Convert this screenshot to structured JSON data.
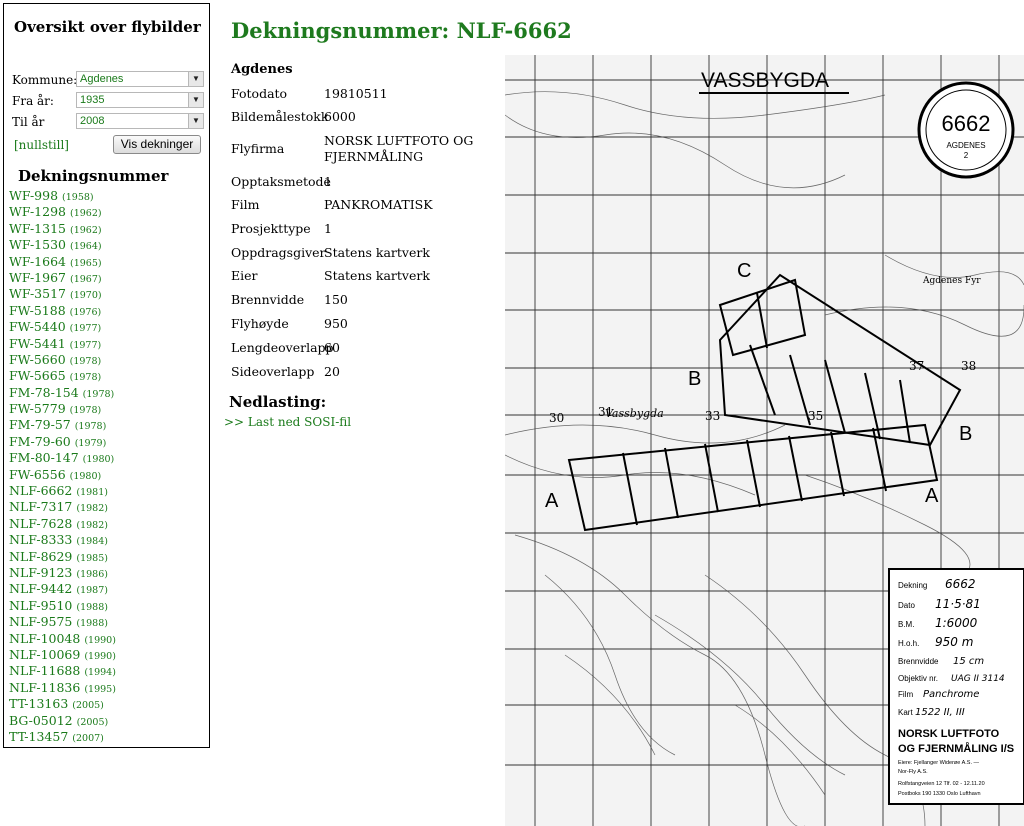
{
  "sidebar": {
    "title": "Oversikt over flybilder",
    "kommune_label": "Kommune:",
    "kommune_value": "Agdenes",
    "fra_label": "Fra år:",
    "fra_value": "1935",
    "til_label": "Til år",
    "til_value": "2008",
    "reset_link": "[nullstill]",
    "show_button": "Vis dekninger",
    "list_heading": "Dekningsnummer",
    "items": [
      {
        "id": "WF-998",
        "year": "(1958)"
      },
      {
        "id": "WF-1298",
        "year": "(1962)"
      },
      {
        "id": "WF-1315",
        "year": "(1962)"
      },
      {
        "id": "WF-1530",
        "year": "(1964)"
      },
      {
        "id": "WF-1664",
        "year": "(1965)"
      },
      {
        "id": "WF-1967",
        "year": "(1967)"
      },
      {
        "id": "WF-3517",
        "year": "(1970)"
      },
      {
        "id": "FW-5188",
        "year": "(1976)"
      },
      {
        "id": "FW-5440",
        "year": "(1977)"
      },
      {
        "id": "FW-5441",
        "year": "(1977)"
      },
      {
        "id": "FW-5660",
        "year": "(1978)"
      },
      {
        "id": "FW-5665",
        "year": "(1978)"
      },
      {
        "id": "FM-78-154",
        "year": "(1978)"
      },
      {
        "id": "FW-5779",
        "year": "(1978)"
      },
      {
        "id": "FM-79-57",
        "year": "(1978)"
      },
      {
        "id": "FM-79-60",
        "year": "(1979)"
      },
      {
        "id": "FM-80-147",
        "year": "(1980)"
      },
      {
        "id": "FW-6556",
        "year": "(1980)"
      },
      {
        "id": "NLF-6662",
        "year": "(1981)"
      },
      {
        "id": "NLF-7317",
        "year": "(1982)"
      },
      {
        "id": "NLF-7628",
        "year": "(1982)"
      },
      {
        "id": "NLF-8333",
        "year": "(1984)"
      },
      {
        "id": "NLF-8629",
        "year": "(1985)"
      },
      {
        "id": "NLF-9123",
        "year": "(1986)"
      },
      {
        "id": "NLF-9442",
        "year": "(1987)"
      },
      {
        "id": "NLF-9510",
        "year": "(1988)"
      },
      {
        "id": "NLF-9575",
        "year": "(1988)"
      },
      {
        "id": "NLF-10048",
        "year": "(1990)"
      },
      {
        "id": "NLF-10069",
        "year": "(1990)"
      },
      {
        "id": "NLF-11688",
        "year": "(1994)"
      },
      {
        "id": "NLF-11836",
        "year": "(1995)"
      },
      {
        "id": "TT-13163",
        "year": "(2005)"
      },
      {
        "id": "BG-05012",
        "year": "(2005)"
      },
      {
        "id": "TT-13457",
        "year": "(2007)"
      }
    ]
  },
  "main": {
    "title": "Dekningsnummer: NLF-6662",
    "kommune": "Agdenes",
    "details": [
      {
        "key": "Fotodato",
        "value": "19810511"
      },
      {
        "key": "Bildemålestokk",
        "value": "6000"
      },
      {
        "key": "Flyfirma",
        "value": "NORSK LUFTFOTO OG FJERNMÅLING"
      },
      {
        "key": "Opptaksmetode",
        "value": "1"
      },
      {
        "key": "Film",
        "value": "PANKROMATISK"
      },
      {
        "key": "Prosjekttype",
        "value": "1"
      },
      {
        "key": "Oppdragsgiver",
        "value": "Statens kartverk"
      },
      {
        "key": "Eier",
        "value": "Statens kartverk"
      },
      {
        "key": "Brennvidde",
        "value": "150"
      },
      {
        "key": "Flyhøyde",
        "value": "950"
      },
      {
        "key": "Lengdeoverlapp",
        "value": "60"
      },
      {
        "key": "Sideoverlapp",
        "value": "20"
      }
    ],
    "download_heading": "Nedlasting:",
    "download_link": ">> Last ned SOSI-fil"
  },
  "map": {
    "place_name": "VASSBYGDA",
    "stamp_number": "6662",
    "stamp_sub": "AGDENES",
    "stamp_mark": "2",
    "strip_labels": [
      "A",
      "A",
      "B",
      "B",
      "C"
    ],
    "grid_numbers": [
      "30",
      "31",
      "33",
      "35",
      "37",
      "38"
    ],
    "place_labels": [
      "Vassbygda",
      "Agdenes Fyr"
    ],
    "info_box": {
      "rows": [
        {
          "label": "Dekning",
          "value": "6662"
        },
        {
          "label": "Dato",
          "value": "11·5·81"
        },
        {
          "label": "B.M.",
          "value": "1:6000"
        },
        {
          "label": "H.o.h.",
          "value": "950 m"
        },
        {
          "label": "Brennvidde",
          "value": "15 cm"
        },
        {
          "label": "Objektiv nr.",
          "value": "UAG II 3114"
        },
        {
          "label": "Film",
          "value": "Panchrome"
        },
        {
          "label": "Kart",
          "value": "1522 II, III"
        }
      ],
      "company_line1": "NORSK LUFTFOTO",
      "company_line2": "OG FJERNMÅLING I/S",
      "small_lines": [
        "Eiere: Fjellanger Widerøe A.S. —",
        "Nor-Fly A.S.",
        "Rolfstangveien 12  Tlf. 02 - 12.11.20",
        "Postboks 190   1330 Oslo Lufthavn"
      ]
    }
  }
}
